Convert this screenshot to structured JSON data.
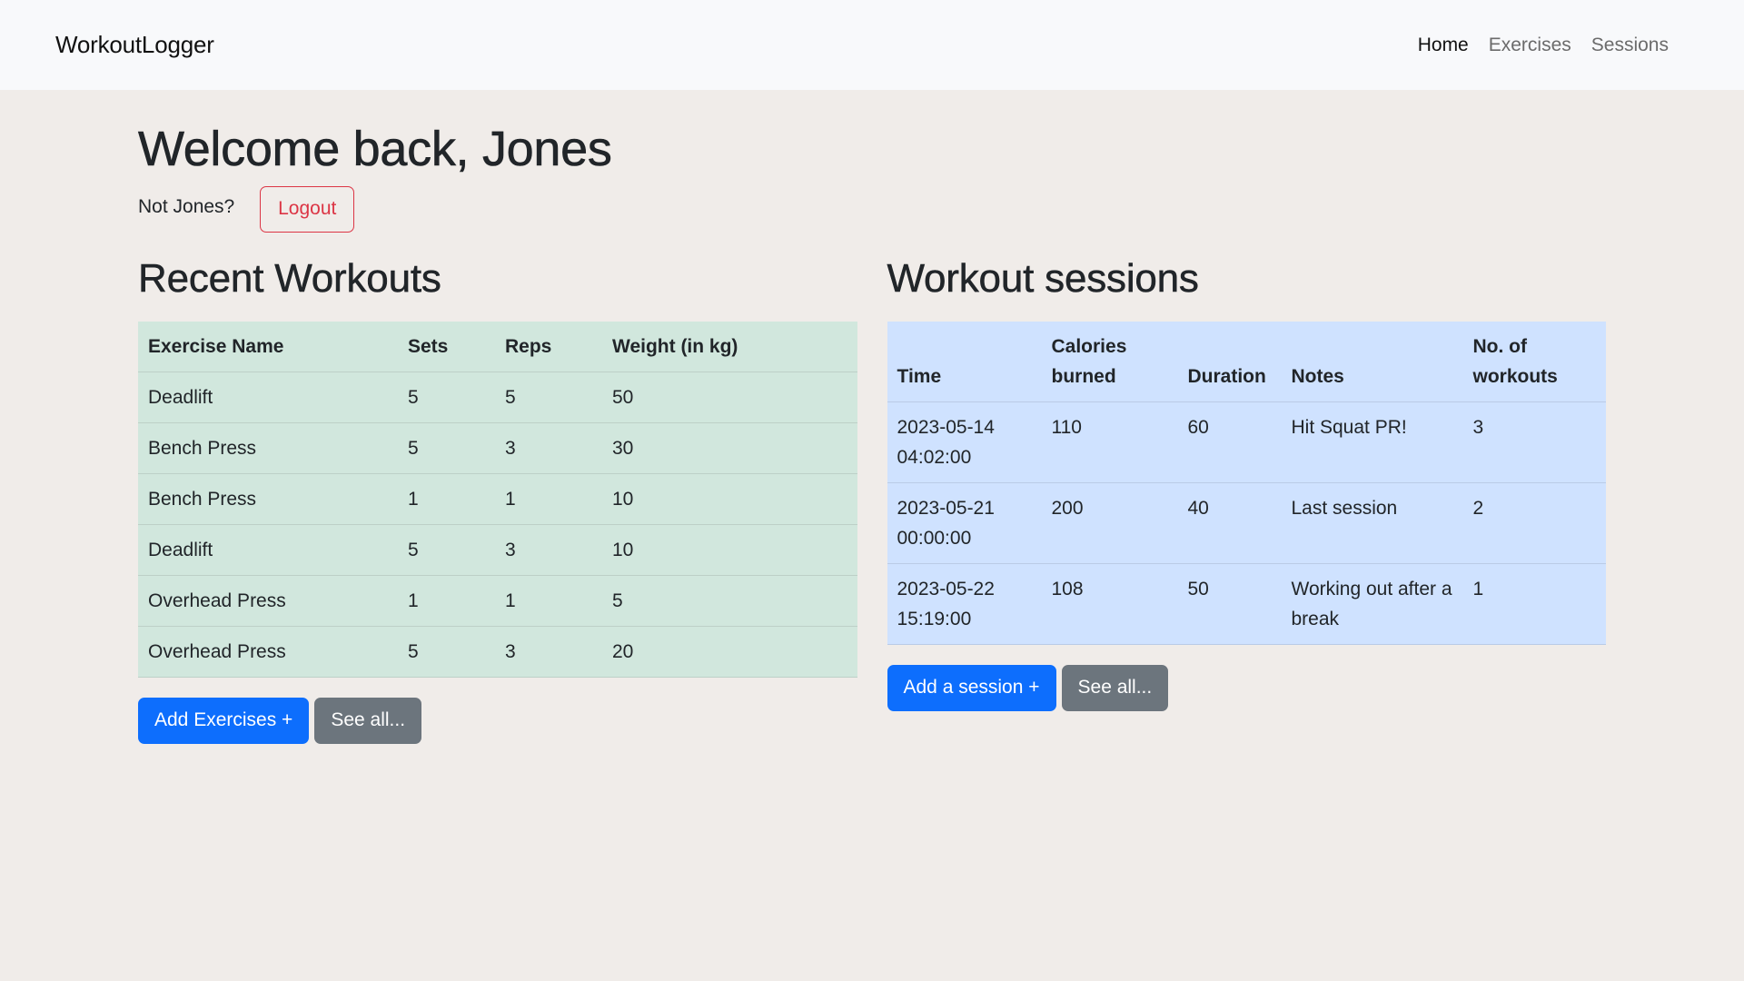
{
  "navbar": {
    "brand": "WorkoutLogger",
    "links": [
      {
        "label": "Home",
        "active": true
      },
      {
        "label": "Exercises",
        "active": false
      },
      {
        "label": "Sessions",
        "active": false
      }
    ]
  },
  "welcome": {
    "title": "Welcome back, Jones",
    "not_user_text": "Not Jones?",
    "logout_label": "Logout"
  },
  "recent_workouts": {
    "title": "Recent Workouts",
    "columns": [
      "Exercise Name",
      "Sets",
      "Reps",
      "Weight (in kg)"
    ],
    "rows": [
      [
        "Deadlift",
        "5",
        "5",
        "50"
      ],
      [
        "Bench Press",
        "5",
        "3",
        "30"
      ],
      [
        "Bench Press",
        "1",
        "1",
        "10"
      ],
      [
        "Deadlift",
        "5",
        "3",
        "10"
      ],
      [
        "Overhead Press",
        "1",
        "1",
        "5"
      ],
      [
        "Overhead Press",
        "5",
        "3",
        "20"
      ]
    ],
    "add_label": "Add Exercises +",
    "see_all_label": "See all..."
  },
  "sessions": {
    "title": "Workout sessions",
    "columns": [
      "Time",
      "Calories burned",
      "Duration",
      "Notes",
      "No. of workouts"
    ],
    "rows": [
      [
        "2023-05-14 04:02:00",
        "110",
        "60",
        "Hit Squat PR!",
        "3"
      ],
      [
        "2023-05-21 00:00:00",
        "200",
        "40",
        "Last session",
        "2"
      ],
      [
        "2023-05-22 15:19:00",
        "108",
        "50",
        "Working out after a break",
        "1"
      ]
    ],
    "add_label": "Add a session +",
    "see_all_label": "See all..."
  },
  "colors": {
    "background": "#f0ece9",
    "navbar_bg": "#f8f9fb",
    "primary": "#0d6efd",
    "secondary": "#6c757d",
    "danger": "#dc3545",
    "table_green": "#d1e7dd",
    "table_blue": "#cfe2ff"
  }
}
